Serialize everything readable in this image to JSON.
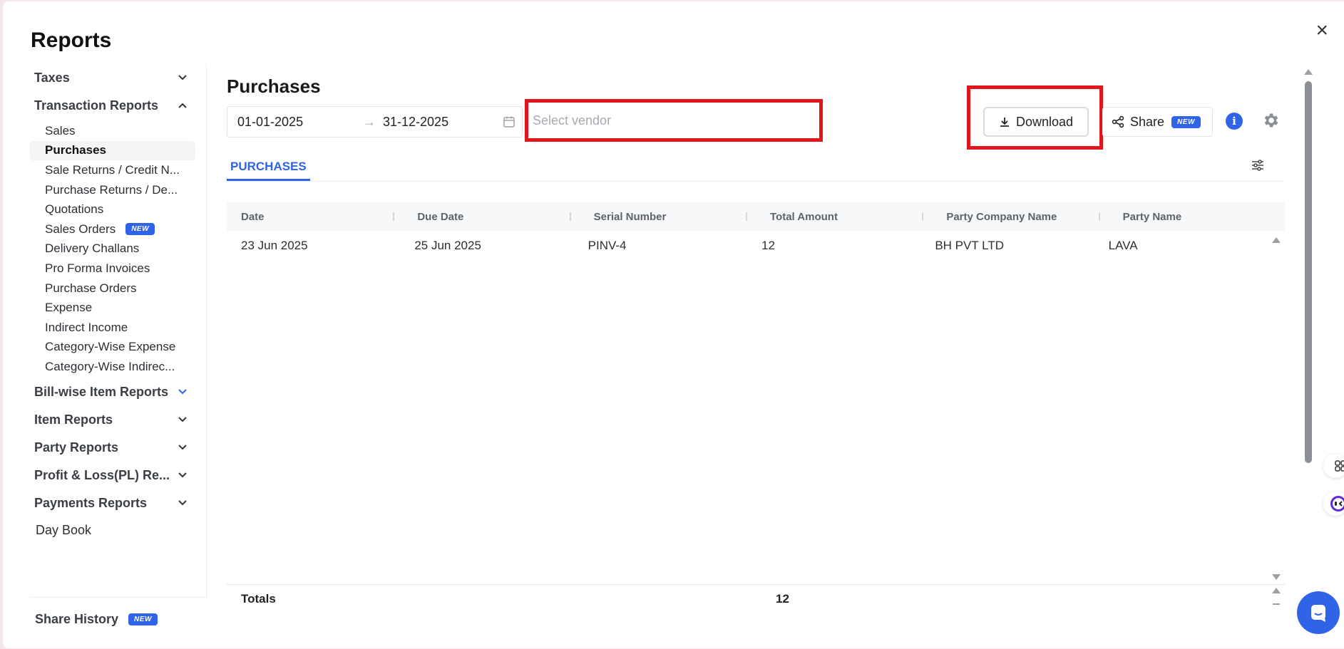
{
  "modal": {
    "title": "Reports",
    "close_label": "×"
  },
  "sidebar": {
    "sections": [
      {
        "label": "Taxes"
      },
      {
        "label": "Transaction Reports"
      }
    ],
    "transaction_items": [
      {
        "label": "Sales"
      },
      {
        "label": "Purchases"
      },
      {
        "label": "Sale Returns / Credit N..."
      },
      {
        "label": "Purchase Returns / De..."
      },
      {
        "label": "Quotations"
      },
      {
        "label": "Sales Orders",
        "badge": "NEW"
      },
      {
        "label": "Delivery Challans"
      },
      {
        "label": "Pro Forma Invoices"
      },
      {
        "label": "Purchase Orders"
      },
      {
        "label": "Expense"
      },
      {
        "label": "Indirect Income"
      },
      {
        "label": "Category-Wise Expense"
      },
      {
        "label": "Category-Wise Indirec..."
      }
    ],
    "more_sections": [
      {
        "label": "Bill-wise Item Reports"
      },
      {
        "label": "Item Reports"
      },
      {
        "label": "Party Reports"
      },
      {
        "label": "Profit & Loss(PL) Re..."
      },
      {
        "label": "Payments Reports"
      }
    ],
    "day_book": "Day Book",
    "share_history": {
      "label": "Share History",
      "badge": "NEW"
    }
  },
  "main": {
    "title": "Purchases",
    "date_from": "01-01-2025",
    "date_to": "31-12-2025",
    "vendor_placeholder": "Select vendor",
    "download_label": "Download",
    "share_label": "Share",
    "share_badge": "NEW",
    "info_label": "i",
    "tab_label": "PURCHASES"
  },
  "table": {
    "columns": [
      "Date",
      "Due Date",
      "Serial Number",
      "Total Amount",
      "Party Company Name",
      "Party Name"
    ],
    "rows": [
      [
        "23 Jun 2025",
        "25 Jun 2025",
        "PINV-4",
        "12",
        "BH PVT LTD",
        "LAVA"
      ]
    ],
    "totals": {
      "label": "Totals",
      "total_amount": "12"
    }
  },
  "colors": {
    "accent": "#2f63e8",
    "highlight": "#e0161c"
  }
}
